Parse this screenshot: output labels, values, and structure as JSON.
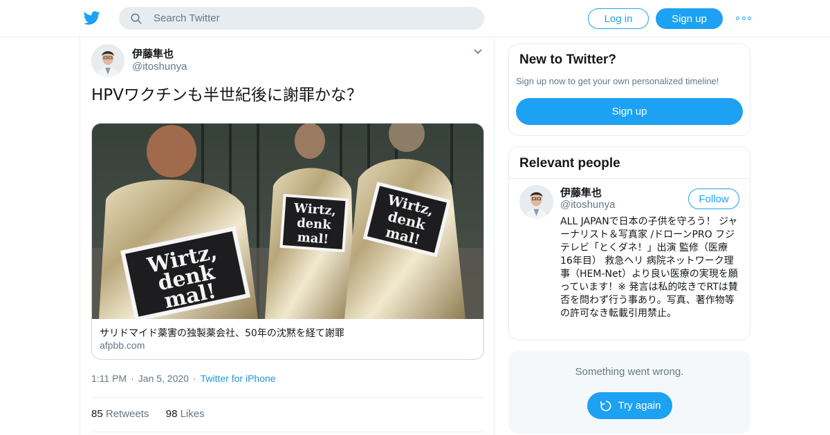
{
  "header": {
    "logo_icon": "twitter-bird-icon",
    "search_placeholder": "Search Twitter",
    "login_label": "Log in",
    "signup_label": "Sign up",
    "more_icon": "more-dots-icon",
    "accent_color": "#1da1f2"
  },
  "tweet": {
    "author_name": "伊藤隼也",
    "author_handle": "@itoshunya",
    "text": "HPVワクチンも半世紀後に謝罪かな？",
    "card": {
      "image_signs": [
        "Wirtz,",
        "denk",
        "mal!"
      ],
      "title": "サリドマイド薬害の独製薬会社、50年の沈黙を経て謝罪",
      "domain": "afpbb.com"
    },
    "time": "1:11 PM",
    "date": "Jan 5, 2020",
    "source": "Twitter for iPhone",
    "retweets_count": "85",
    "retweets_label": "Retweets",
    "likes_count": "98",
    "likes_label": "Likes"
  },
  "sidebar": {
    "new_to_twitter": {
      "title": "New to Twitter?",
      "subtitle": "Sign up now to get your own personalized timeline!",
      "button_label": "Sign up"
    },
    "relevant_people": {
      "title": "Relevant people",
      "person": {
        "name": "伊藤隼也",
        "handle": "@itoshunya",
        "follow_label": "Follow",
        "bio": "ALL JAPANで日本の子供を守ろう！ ジャーナリスト＆写真家 /ドローンPRO フジテレビ「とくダネ！」出演 監修（医療 16年目） 救急ヘリ 病院ネットワーク理事（HEM-Net）より良い医療の実現を願っています！※ 発言は私的呟きでRTは賛否を問わず行う事あり。写真、著作物等の許可なき転載引用禁止。"
      }
    },
    "error": {
      "message": "Something went wrong.",
      "retry_label": "Try again"
    }
  }
}
